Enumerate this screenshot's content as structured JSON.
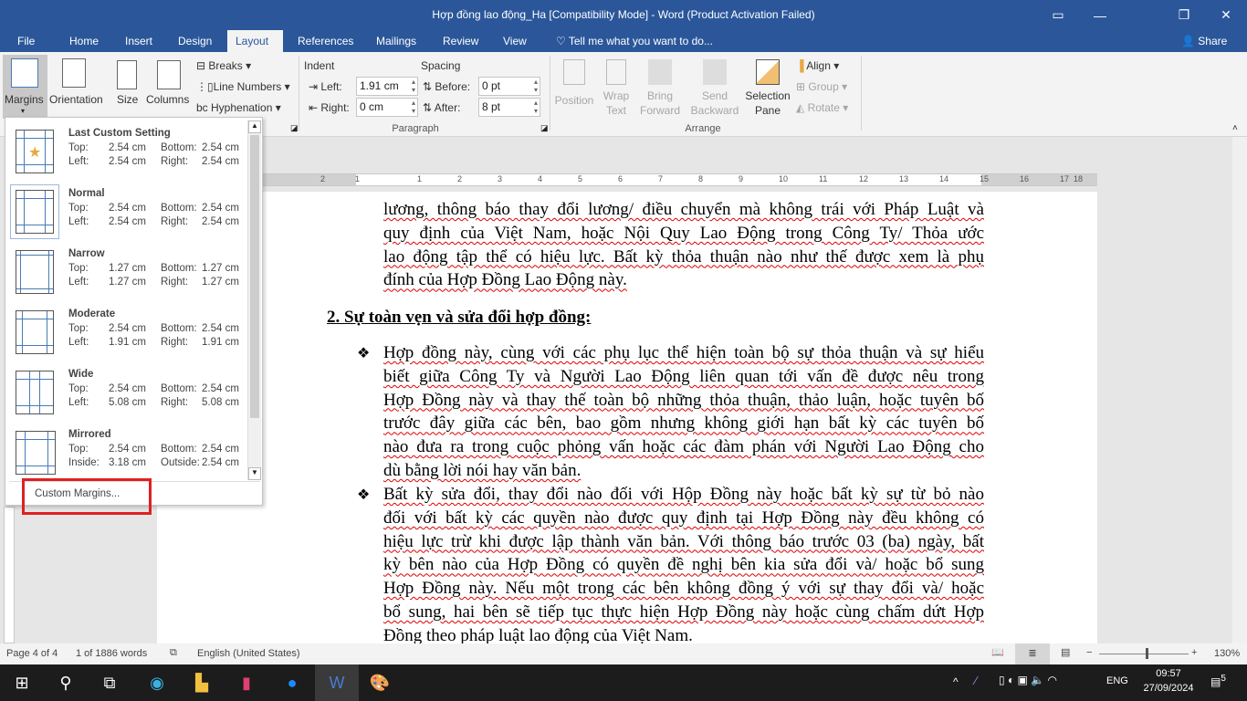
{
  "window": {
    "title": "Hợp đồng lao động_Ha [Compatibility Mode] - Word (Product Activation Failed)",
    "accent": "#2b579a"
  },
  "tabs": [
    "File",
    "Home",
    "Insert",
    "Design",
    "Layout",
    "References",
    "Mailings",
    "Review",
    "View"
  ],
  "active_tab": "Layout",
  "tell_me": "Tell me what you want to do...",
  "share": "Share",
  "ribbon": {
    "page_setup": {
      "margins": "Margins",
      "orientation": "Orientation",
      "size": "Size",
      "columns": "Columns",
      "breaks": "Breaks",
      "line_numbers": "Line Numbers",
      "hyphenation": "Hyphenation"
    },
    "paragraph": {
      "group": "Paragraph",
      "indent": "Indent",
      "spacing": "Spacing",
      "left_label": "Left:",
      "left_value": "1.91 cm",
      "right_label": "Right:",
      "right_value": "0 cm",
      "before_label": "Before:",
      "before_value": "0 pt",
      "after_label": "After:",
      "after_value": "8 pt"
    },
    "arrange": {
      "group": "Arrange",
      "position": "Position",
      "wrap1": "Wrap",
      "wrap2": "Text",
      "bring1": "Bring",
      "bring2": "Forward",
      "send1": "Send",
      "send2": "Backward",
      "sel1": "Selection",
      "sel2": "Pane",
      "align": "Align",
      "group_btn": "Group",
      "rotate": "Rotate"
    }
  },
  "ruler_ticks": [
    "2",
    "1",
    "1",
    "2",
    "3",
    "4",
    "5",
    "6",
    "7",
    "8",
    "9",
    "10",
    "11",
    "12",
    "13",
    "14",
    "15",
    "16",
    "17",
    "18"
  ],
  "margins_menu": {
    "items": [
      {
        "name": "Last Custom Setting",
        "r1": [
          "Top:",
          "2.54 cm",
          "Bottom:",
          "2.54 cm"
        ],
        "r2": [
          "Left:",
          "2.54 cm",
          "Right:",
          "2.54 cm"
        ]
      },
      {
        "name": "Normal",
        "r1": [
          "Top:",
          "2.54 cm",
          "Bottom:",
          "2.54 cm"
        ],
        "r2": [
          "Left:",
          "2.54 cm",
          "Right:",
          "2.54 cm"
        ]
      },
      {
        "name": "Narrow",
        "r1": [
          "Top:",
          "1.27 cm",
          "Bottom:",
          "1.27 cm"
        ],
        "r2": [
          "Left:",
          "1.27 cm",
          "Right:",
          "1.27 cm"
        ]
      },
      {
        "name": "Moderate",
        "r1": [
          "Top:",
          "2.54 cm",
          "Bottom:",
          "2.54 cm"
        ],
        "r2": [
          "Left:",
          "1.91 cm",
          "Right:",
          "1.91 cm"
        ]
      },
      {
        "name": "Wide",
        "r1": [
          "Top:",
          "2.54 cm",
          "Bottom:",
          "2.54 cm"
        ],
        "r2": [
          "Left:",
          "5.08 cm",
          "Right:",
          "5.08 cm"
        ]
      },
      {
        "name": "Mirrored",
        "r1": [
          "Top:",
          "2.54 cm",
          "Bottom:",
          "2.54 cm"
        ],
        "r2": [
          "Inside:",
          "3.18 cm",
          "Outside:",
          "2.54 cm"
        ]
      }
    ],
    "custom": "Custom Margins..."
  },
  "document": {
    "p1": [
      "lương, thông báo thay đổi lương/ điều chuyển mà không trái với Pháp Luật và",
      "quy định của Việt Nam, hoặc Nội Quy Lao Động trong Công Ty/ Thỏa ước",
      "lao động tập thể có hiệu lực. Bất kỳ thỏa thuận nào như thế được xem là phụ",
      "đính của Hợp Đồng Lao Động này."
    ],
    "heading": "2. Sự toàn vẹn và sửa đổi hợp đồng:",
    "bullet": "❖",
    "b1": [
      "Hợp đồng này, cùng với các phụ lục thể hiện toàn bộ sự thỏa thuận và sự hiểu",
      "biết giữa Công Ty và Người Lao Động liên quan tới vấn đề được nêu trong",
      "Hợp Đồng này và thay thế toàn bộ những thỏa thuận, thảo luận, hoặc tuyên bố",
      "trước đây giữa các bên, bao gồm nhưng không giới hạn bất kỳ các tuyên bố",
      "nào đưa ra trong cuộc phỏng vấn hoặc các đàm phán với Người Lao Động cho",
      "dù bằng lời nói hay văn bản."
    ],
    "b2": [
      "Bất kỳ sửa đổi, thay đổi nào đối với Hộp Đồng này hoặc bất kỳ sự từ bỏ nào",
      "đối với bất kỳ các quyền nào được quy định tại Hợp Đồng này đều không có",
      "hiệu lực trừ khi được lập thành văn bản. Với thông báo trước 03 (ba) ngày, bất",
      "kỳ bên nào của Hợp Đồng có quyền đề nghị bên kia sửa đổi và/ hoặc bổ sung",
      "Hợp Đồng này. Nếu một trong các bên không đồng ý với sự thay đổi và/ hoặc",
      "bổ sung, hai bên sẽ tiếp tục thực hiện Hợp Đồng này hoặc cùng chấm dứt Hợp",
      "Đồng theo pháp luật lao động của Việt Nam."
    ]
  },
  "status": {
    "page": "Page 4 of 4",
    "words": "1 of 1886 words",
    "language": "English (United States)",
    "zoom": "130%"
  },
  "taskbar": {
    "language": "ENG",
    "time": "09:57",
    "date": "27/09/2024",
    "notifications": "5"
  }
}
